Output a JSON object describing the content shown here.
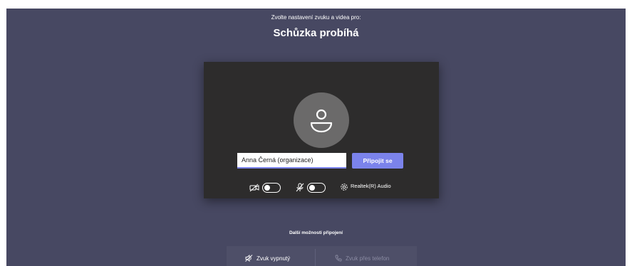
{
  "header": {
    "subtitle": "Zvolte nastavení zvuku a videa pro:",
    "meeting_title": "Schůzka probíhá"
  },
  "prejoin": {
    "avatar_icon": "person-icon",
    "name_value": "Anna Černá (organizace)",
    "join_label": "Připojit se",
    "controls": {
      "camera_icon": "camera-off-icon",
      "camera_on": false,
      "mic_icon": "mic-off-icon",
      "mic_on": false,
      "device_icon": "gear-icon",
      "audio_device": "Realtek(R) Audio"
    }
  },
  "other_options": {
    "heading": "Další možnosti připojení",
    "audio_off_label": "Zvuk vypnutý",
    "phone_label": "Zvuk přes telefon"
  },
  "colors": {
    "background": "#474862",
    "card": "#2d2c2c",
    "accent": "#7b83eb",
    "avatar": "#6b6a6a"
  }
}
